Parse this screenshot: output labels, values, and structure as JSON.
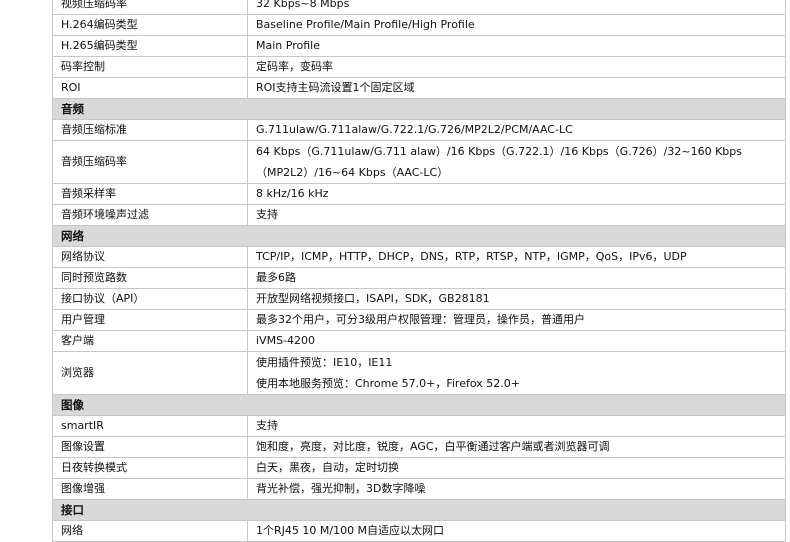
{
  "spec_table": {
    "rows": [
      {
        "type": "row",
        "label": "",
        "lines": [
          ""
        ]
      },
      {
        "type": "row",
        "label": "视频压缩码率",
        "lines": [
          "32 Kbps~8 Mbps"
        ]
      },
      {
        "type": "row",
        "label": "H.264编码类型",
        "lines": [
          "Baseline Profile/Main Profile/High Profile"
        ]
      },
      {
        "type": "row",
        "label": "H.265编码类型",
        "lines": [
          "Main Profile"
        ]
      },
      {
        "type": "row",
        "label": "码率控制",
        "lines": [
          "定码率，变码率"
        ]
      },
      {
        "type": "row",
        "label": "ROI",
        "lines": [
          "ROI支持主码流设置1个固定区域"
        ]
      },
      {
        "type": "section",
        "label": "音频"
      },
      {
        "type": "row",
        "label": "音频压缩标准",
        "lines": [
          "G.711ulaw/G.711alaw/G.722.1/G.726/MP2L2/PCM/AAC-LC"
        ]
      },
      {
        "type": "row",
        "label": "音频压缩码率",
        "lines": [
          "64 Kbps（G.711ulaw/G.711 alaw）/16 Kbps（G.722.1）/16 Kbps（G.726）/32~160 Kbps",
          "（MP2L2）/16~64 Kbps（AAC-LC）"
        ]
      },
      {
        "type": "row",
        "label": "音频采样率",
        "lines": [
          "8 kHz/16 kHz"
        ]
      },
      {
        "type": "row",
        "label": "音频环境噪声过滤",
        "lines": [
          "支持"
        ]
      },
      {
        "type": "section",
        "label": "网络"
      },
      {
        "type": "row",
        "label": "网络协议",
        "lines": [
          "TCP/IP，ICMP，HTTP，DHCP，DNS，RTP，RTSP，NTP，IGMP，QoS，IPv6，UDP"
        ]
      },
      {
        "type": "row",
        "label": "同时预览路数",
        "lines": [
          "最多6路"
        ]
      },
      {
        "type": "row",
        "label": "接口协议（API）",
        "lines": [
          "开放型网络视频接口，ISAPI，SDK，GB28181"
        ]
      },
      {
        "type": "row",
        "label": "用户管理",
        "lines": [
          "最多32个用户，可分3级用户权限管理：管理员，操作员，普通用户"
        ]
      },
      {
        "type": "row",
        "label": "客户端",
        "lines": [
          "iVMS-4200"
        ]
      },
      {
        "type": "row",
        "label": "浏览器",
        "lines": [
          "使用插件预览：IE10，IE11",
          "使用本地服务预览：Chrome 57.0+，Firefox 52.0+"
        ]
      },
      {
        "type": "section",
        "label": "图像"
      },
      {
        "type": "row",
        "label": "smartIR",
        "lines": [
          "支持"
        ]
      },
      {
        "type": "row",
        "label": "图像设置",
        "lines": [
          "饱和度，亮度，对比度，锐度，AGC，白平衡通过客户端或者浏览器可调"
        ]
      },
      {
        "type": "row",
        "label": "日夜转换模式",
        "lines": [
          "白天，黑夜，自动，定时切换"
        ]
      },
      {
        "type": "row",
        "label": "图像增强",
        "lines": [
          "背光补偿，强光抑制，3D数字降噪"
        ]
      },
      {
        "type": "section",
        "label": "接口"
      },
      {
        "type": "row",
        "label": "网络",
        "lines": [
          "1个RJ45 10 M/100 M自适应以太网口"
        ]
      }
    ]
  }
}
